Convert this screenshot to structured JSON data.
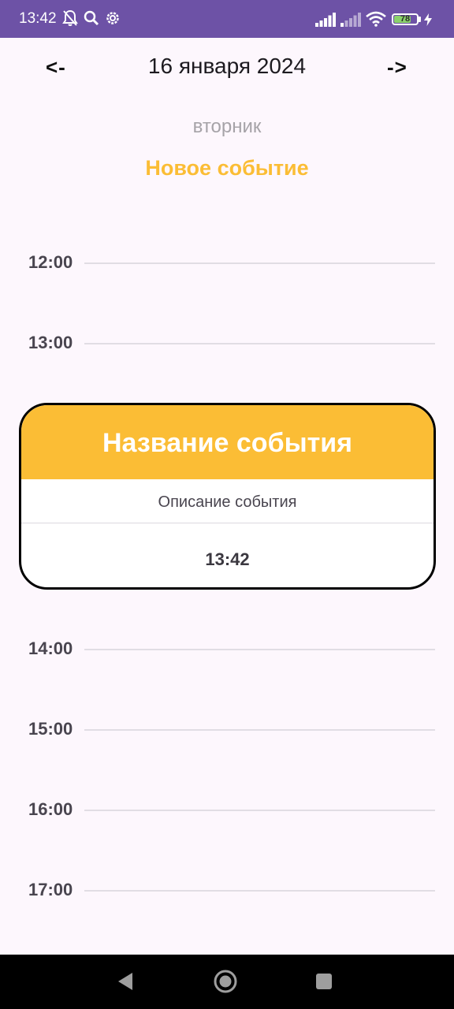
{
  "status_bar": {
    "time": "13:42",
    "battery_level": "78",
    "battery_fraction": 0.78,
    "icons": [
      "bell-off-icon",
      "search-icon",
      "settings-icon",
      "signal-icon",
      "signal-weak-icon",
      "wifi-icon",
      "battery-icon",
      "charging-icon"
    ],
    "background_color": "#6d52a6"
  },
  "header": {
    "prev_label": "<-",
    "date": "16 января 2024",
    "next_label": "->",
    "weekday": "вторник",
    "new_event_label": "Новое событие"
  },
  "hours": {
    "h12": "12:00",
    "h13": "13:00",
    "h14": "14:00",
    "h15": "15:00",
    "h16": "16:00",
    "h17": "17:00"
  },
  "event": {
    "title": "Название события",
    "description": "Описание события",
    "time": "13:42"
  },
  "colors": {
    "accent": "#fbbd35",
    "background": "#fdf7fd"
  },
  "nav_bar": {
    "icons": [
      "back-icon",
      "home-icon",
      "recents-icon"
    ]
  }
}
